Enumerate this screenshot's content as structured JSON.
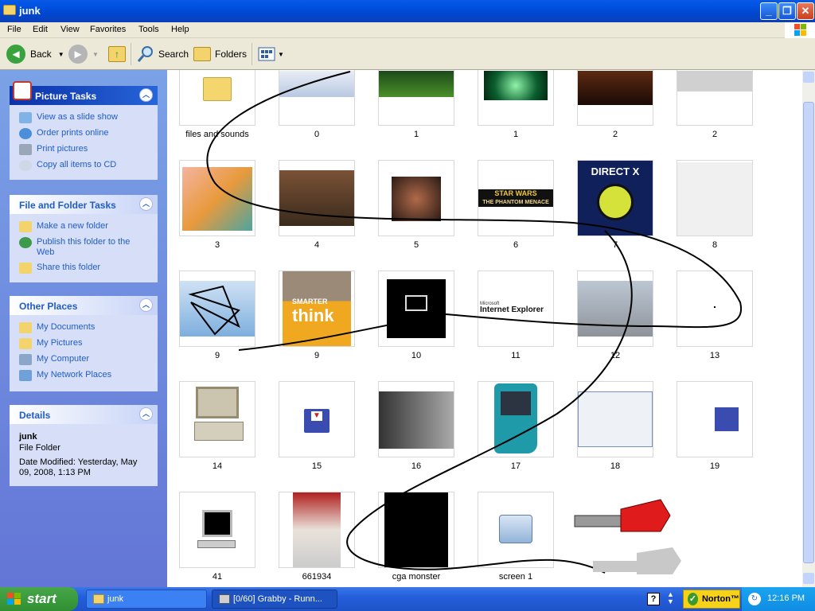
{
  "window": {
    "title": "junk"
  },
  "menu": [
    "File",
    "Edit",
    "View",
    "Favorites",
    "Tools",
    "Help"
  ],
  "toolbar": {
    "back": "Back",
    "search": "Search",
    "folders": "Folders"
  },
  "sidebar": {
    "picture_tasks": {
      "title": "Picture Tasks",
      "items": [
        "View as a slide show",
        "Order prints online",
        "Print pictures",
        "Copy all items to CD"
      ]
    },
    "file_folder_tasks": {
      "title": "File and Folder Tasks",
      "items": [
        "Make a new folder",
        "Publish this folder to the Web",
        "Share this folder"
      ]
    },
    "other_places": {
      "title": "Other Places",
      "items": [
        "My Documents",
        "My Pictures",
        "My Computer",
        "My Network Places"
      ]
    },
    "details": {
      "title": "Details",
      "name": "junk",
      "type": "File Folder",
      "modified": "Date Modified: Yesterday, May 09, 2008, 1:13 PM"
    }
  },
  "files": [
    {
      "name": "files and sounds"
    },
    {
      "name": "0"
    },
    {
      "name": "1"
    },
    {
      "name": "1"
    },
    {
      "name": "2"
    },
    {
      "name": "2"
    },
    {
      "name": "3"
    },
    {
      "name": "4"
    },
    {
      "name": "5"
    },
    {
      "name": "6"
    },
    {
      "name": "7"
    },
    {
      "name": "8"
    },
    {
      "name": "9"
    },
    {
      "name": "9"
    },
    {
      "name": "10"
    },
    {
      "name": "11"
    },
    {
      "name": "12"
    },
    {
      "name": "13"
    },
    {
      "name": "14"
    },
    {
      "name": "15"
    },
    {
      "name": "16"
    },
    {
      "name": "17"
    },
    {
      "name": "18"
    },
    {
      "name": "19"
    },
    {
      "name": "41"
    },
    {
      "name": "661934"
    },
    {
      "name": "cga monster"
    },
    {
      "name": "screen 1"
    }
  ],
  "thumb_text": {
    "starwars": "STAR WARS",
    "phantom": "THE PHANTOM MENACE",
    "directx": "DIRECT X",
    "microsoft": "Microsoft",
    "ie": "Internet Explorer",
    "smarter": "SMARTER",
    "think": "think"
  },
  "taskbar": {
    "start": "start",
    "app1": "junk",
    "app2": "[0/60] Grabby - Runn...",
    "norton": "Norton™",
    "clock": "12:16 PM"
  },
  "colors": {
    "title_blue": "#0054e3",
    "sidebar_blue": "#6375d6",
    "link_blue": "#215dc6",
    "start_green": "#3c9a3e"
  }
}
